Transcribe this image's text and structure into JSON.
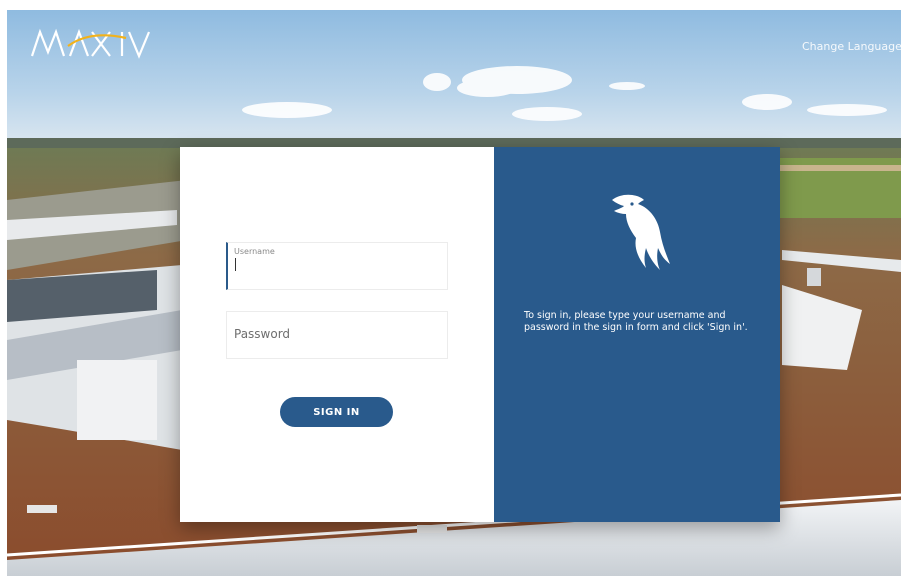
{
  "header": {
    "logo_text": "MAX IV",
    "change_language": "Change Language"
  },
  "login_form": {
    "username_label": "Username",
    "password_placeholder": "Password",
    "signin_label": "SIGN IN"
  },
  "info_panel": {
    "icon": "bird-logo-icon",
    "text": "To sign in, please type your username and password in the sign in form and click 'Sign in'."
  },
  "colors": {
    "panel_blue": "#295a8c",
    "button_blue": "#295a8c",
    "card_white": "#ffffff"
  }
}
